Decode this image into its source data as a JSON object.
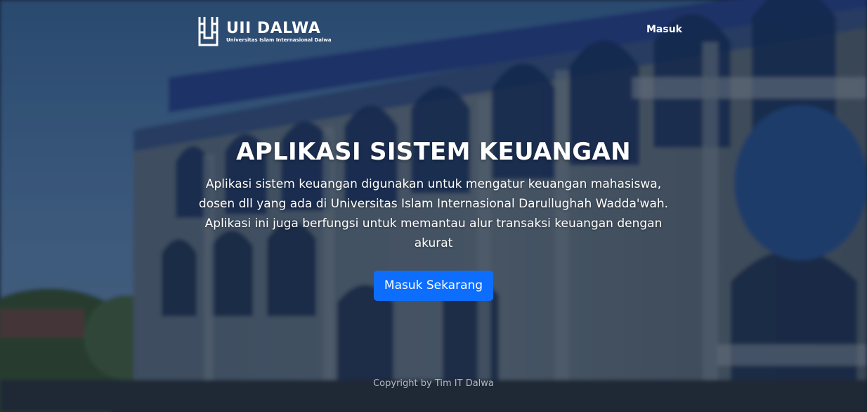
{
  "brand": {
    "name": "UII DALWA",
    "subtitle": "Universitas Islam Internasional Dalwa"
  },
  "nav": {
    "login_label": "Masuk"
  },
  "hero": {
    "title": "APLIKASI SISTEM KEUANGAN",
    "description": "Aplikasi sistem keuangan digunakan untuk mengatur keuangan mahasiswa, dosen dll yang ada di Universitas Islam Internasional Darullughah Wadda'wah. Aplikasi ini juga berfungsi untuk memantau alur transaksi keuangan dengan akurat",
    "cta_label": "Masuk Sekarang"
  },
  "footer": {
    "copyright": "Copyright by Tim IT Dalwa"
  },
  "colors": {
    "primary_button": "#0d6efd",
    "overlay": "#0e1624"
  },
  "icons": {
    "logo": "uii-dalwa-logo-icon",
    "background": "mosque-building-photo"
  }
}
